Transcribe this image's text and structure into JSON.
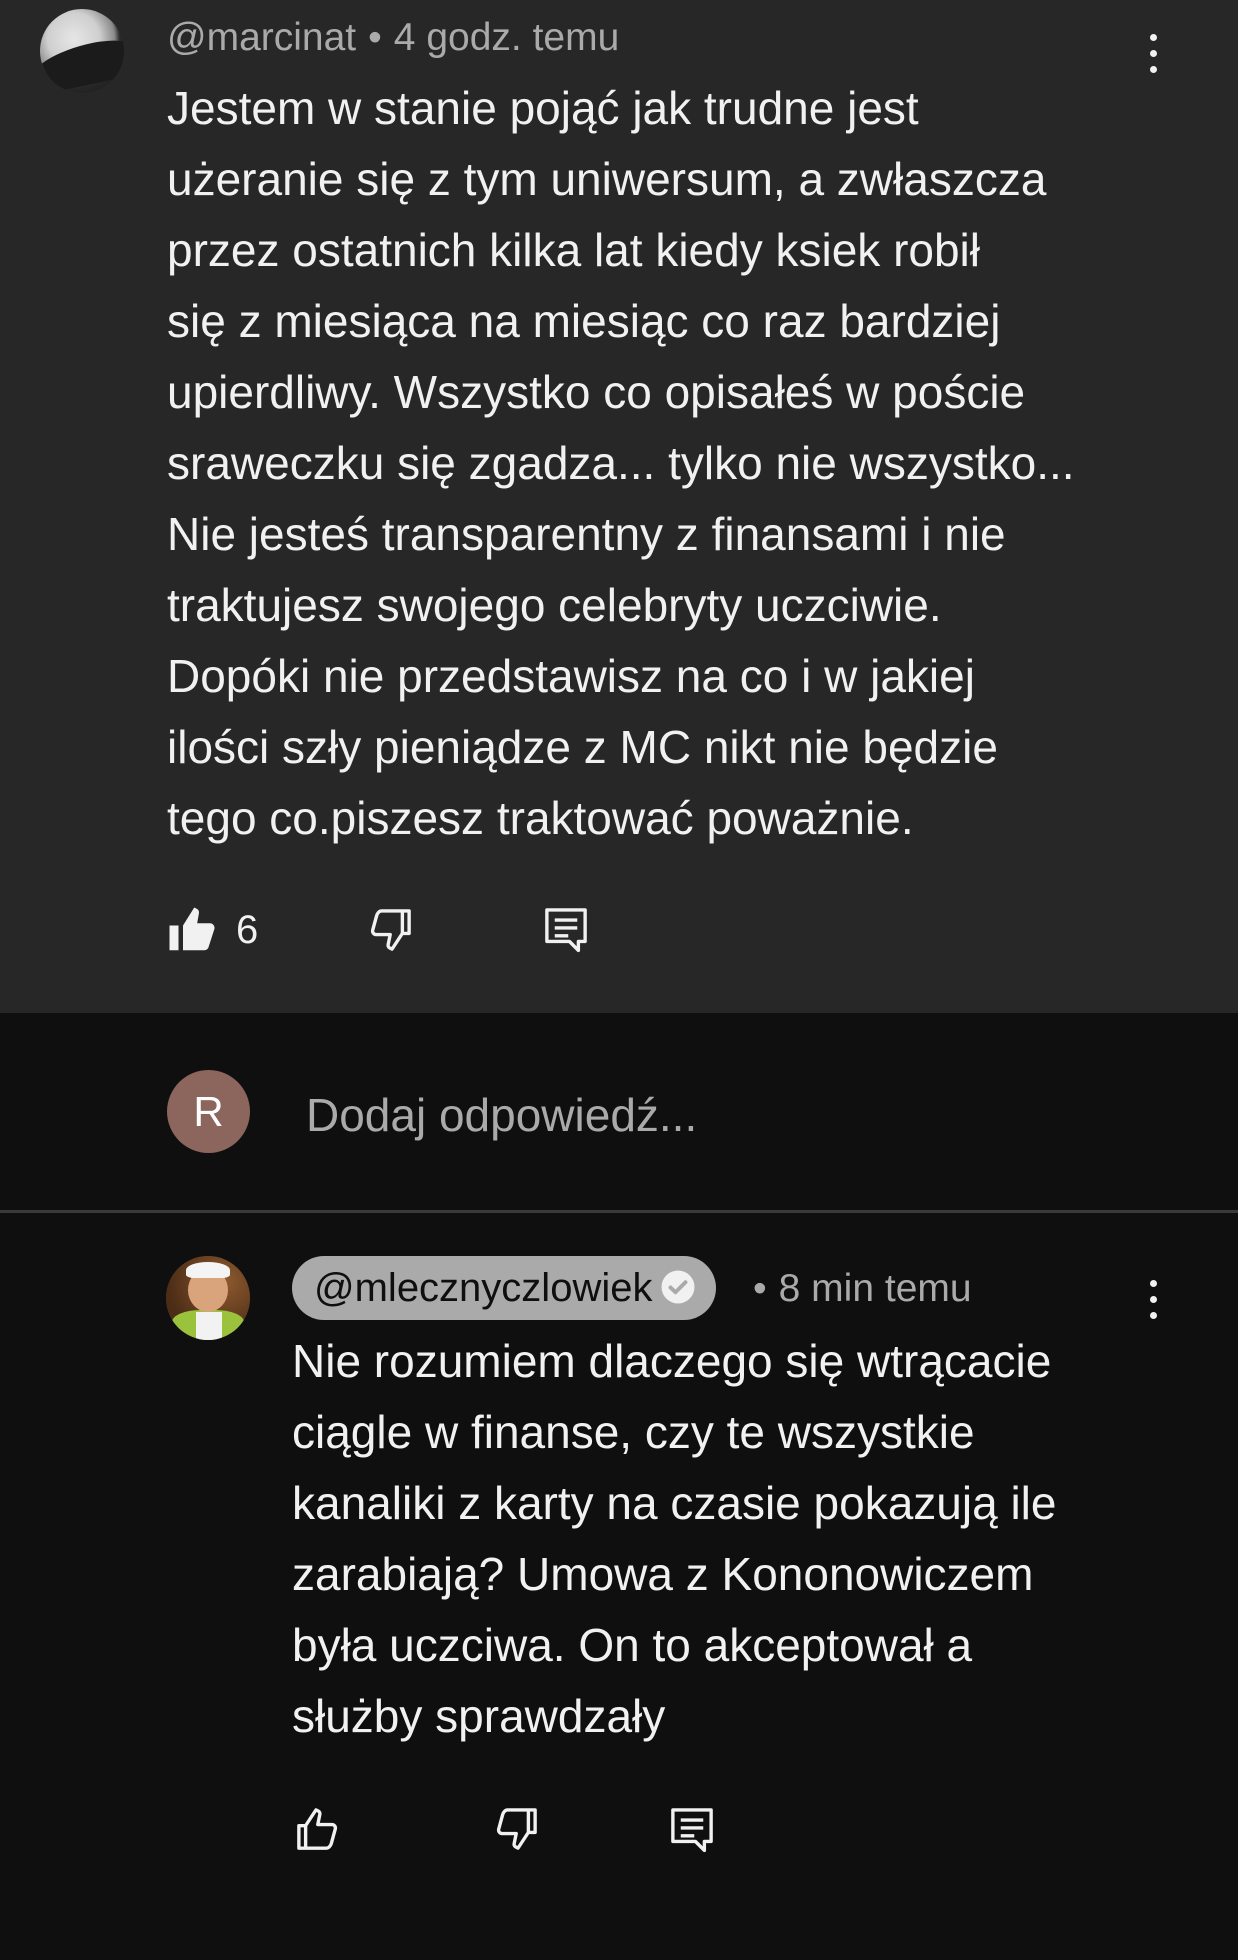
{
  "main_comment": {
    "author": "@marcinat",
    "separator": "•",
    "time": "4 godz. temu",
    "lines": [
      "Jestem w stanie pojąć jak trudne jest",
      "użeranie się z tym uniwersum, a zwłaszcza",
      "przez ostatnich kilka lat kiedy ksiek robił",
      "się z miesiąca na miesiąc co raz bardziej",
      "upierdliwy. Wszystko co opisałeś w poście",
      "sraweczku się zgadza... tylko nie wszystko...",
      "Nie jesteś transparentny z finansami i nie",
      "traktujesz swojego celebryty uczciwie.",
      "Dopóki nie przedstawisz na co i w jakiej",
      "ilości szły pieniądze z MC nikt nie będzie",
      "tego co.piszesz traktować poważnie."
    ],
    "like_count": "6",
    "like_icon": "thumb-up-filled-icon",
    "dislike_icon": "thumb-down-outline-icon",
    "reply_icon": "comment-reply-icon",
    "menu_icon": "more-vertical-icon"
  },
  "reply_box": {
    "avatar_letter": "R",
    "placeholder": "Dodaj odpowiedź..."
  },
  "reply_comment": {
    "author": "@mlecznyczlowiek",
    "verified_icon": "verified-check-icon",
    "separator": "•",
    "time": "8 min temu",
    "lines": [
      "Nie rozumiem dlaczego się wtrącacie",
      "ciągle w finanse, czy te wszystkie",
      "kanaliki z karty na czasie pokazują ile",
      "zarabiają? Umowa z Kononowiczem",
      "była uczciwa. On to akceptował a",
      "służby sprawdzały"
    ],
    "like_icon": "thumb-up-outline-icon",
    "dislike_icon": "thumb-down-outline-icon",
    "reply_icon": "comment-reply-icon",
    "menu_icon": "more-vertical-icon"
  },
  "colors": {
    "background": "#0f0f0f",
    "highlight_background": "#272727",
    "text_primary": "#f1f1f1",
    "text_secondary": "#aaaaaa",
    "user_avatar": "#8c655d",
    "handle_pill": "#aaaaaa"
  }
}
